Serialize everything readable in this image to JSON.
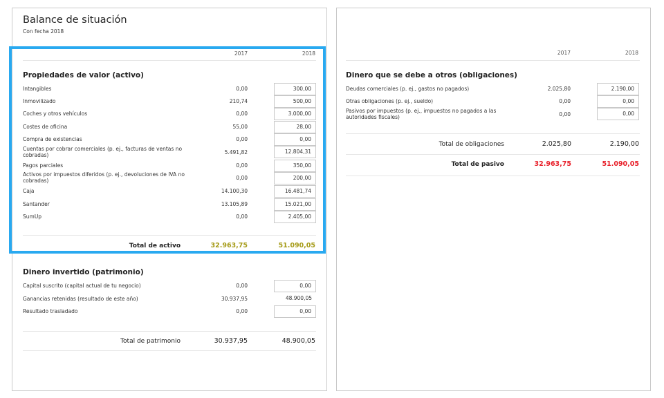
{
  "header": {
    "title": "Balance de situación",
    "subtitle": "Con fecha 2018",
    "year_a": "2017",
    "year_b": "2018"
  },
  "assets": {
    "title": "Propiedades de valor (activo)",
    "rows": [
      {
        "label": "Intangibles",
        "v2017": "0,00",
        "v2018": "300,00"
      },
      {
        "label": "Inmovilizado",
        "v2017": "210,74",
        "v2018": "500,00"
      },
      {
        "label": "Coches y otros vehículos",
        "v2017": "0,00",
        "v2018": "3.000,00"
      },
      {
        "label": "Costes de oficina",
        "v2017": "55,00",
        "v2018": "28,00"
      },
      {
        "label": "Compra de existencias",
        "v2017": "0,00",
        "v2018": "0,00"
      },
      {
        "label": "Cuentas por cobrar comerciales (p. ej., facturas de ventas no cobradas)",
        "v2017": "5.491,82",
        "v2018": "12.804,31"
      },
      {
        "label": "Pagos parciales",
        "v2017": "0,00",
        "v2018": "350,00"
      },
      {
        "label": "Activos por impuestos diferidos (p. ej., devoluciones de IVA no cobradas)",
        "v2017": "0,00",
        "v2018": "200,00"
      },
      {
        "label": "Caja",
        "v2017": "14.100,30",
        "v2018": "16.481,74"
      },
      {
        "label": "Santander",
        "v2017": "13.105,89",
        "v2018": "15.021,00"
      },
      {
        "label": "SumUp",
        "v2017": "0,00",
        "v2018": "2.405,00"
      }
    ],
    "total_label": "Total de activo",
    "total_2017": "32.963,75",
    "total_2018": "51.090,05"
  },
  "equity": {
    "title": "Dinero invertido (patrimonio)",
    "rows": [
      {
        "label": "Capital suscrito (capital actual de tu negocio)",
        "v2017": "0,00",
        "v2018": "0,00"
      },
      {
        "label": "Ganancias retenidas (resultado de este año)",
        "v2017": "30.937,95",
        "v2018": "48.900,05"
      },
      {
        "label": "Resultado trasladado",
        "v2017": "0,00",
        "v2018": "0,00"
      }
    ],
    "total_label": "Total de patrimonio",
    "total_2017": "30.937,95",
    "total_2018": "48.900,05"
  },
  "liabilities": {
    "title": "Dinero que se debe a otros (obligaciones)",
    "rows": [
      {
        "label": "Deudas comerciales (p. ej., gastos no pagados)",
        "v2017": "2.025,80",
        "v2018": "2.190,00"
      },
      {
        "label": "Otras obligaciones (p. ej., sueldo)",
        "v2017": "0,00",
        "v2018": "0,00"
      },
      {
        "label": "Pasivos por impuestos (p. ej., impuestos no pagados a las autoridades fiscales)",
        "v2017": "0,00",
        "v2018": "0,00"
      }
    ],
    "total_label": "Total de obligaciones",
    "total_2017": "2.025,80",
    "total_2018": "2.190,00",
    "grand_label": "Total de pasivo",
    "grand_2017": "32.963,75",
    "grand_2018": "51.090,05"
  },
  "colors": {
    "highlight": "#29a9f0",
    "assets_total": "#a59a16",
    "liabilities_total": "#e8202a"
  }
}
